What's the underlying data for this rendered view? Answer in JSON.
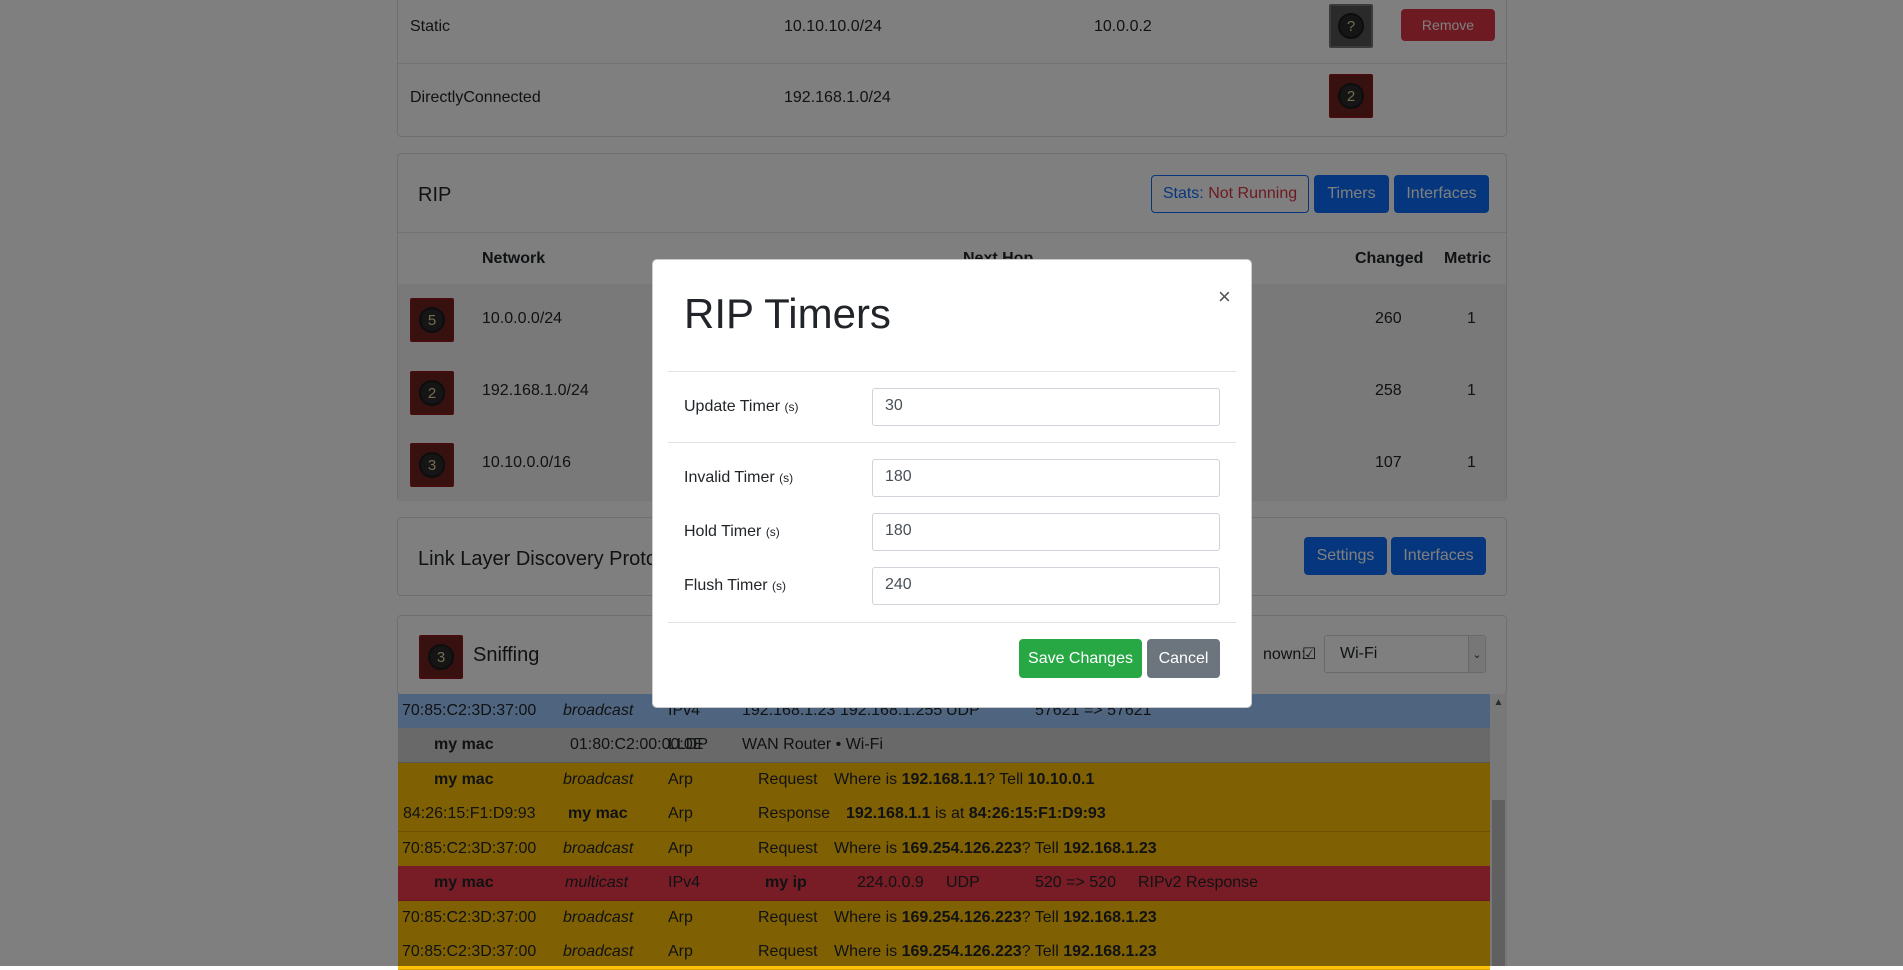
{
  "routes": [
    {
      "type": "Static",
      "network": "10.10.10.0/24",
      "next_hop": "10.0.0.2",
      "icon_label": "?",
      "remove_label": "Remove"
    },
    {
      "type": "DirectlyConnected",
      "network": "192.168.1.0/24",
      "next_hop": "",
      "icon_label": "2"
    }
  ],
  "rip": {
    "title": "RIP",
    "stats_prefix": "Stats:",
    "stats_value": "Not Running",
    "timers_button": "Timers",
    "interfaces_button": "Interfaces",
    "columns": {
      "network": "Network",
      "next_hop": "Next Hop",
      "changed": "Changed",
      "metric": "Metric"
    },
    "rows": [
      {
        "icon_label": "5",
        "network": "10.0.0.0/24",
        "changed": "260",
        "metric": "1"
      },
      {
        "icon_label": "2",
        "network": "192.168.1.0/24",
        "changed": "258",
        "metric": "1"
      },
      {
        "icon_label": "3",
        "network": "10.10.0.0/16",
        "changed": "107",
        "metric": "1"
      }
    ]
  },
  "lldp": {
    "title": "Link Layer Discovery Protocol",
    "settings_button": "Settings",
    "interfaces_button": "Interfaces"
  },
  "sniffing": {
    "icon_label": "3",
    "title": "Sniffing",
    "unknown_label": "nown:",
    "unknown_checkbox": "☑",
    "interface_select": "Wi-Fi",
    "packets": [
      {
        "color": "blue",
        "src": "70:85:C2:3D:37:00",
        "dst": "broadcast",
        "proto": "IPv4",
        "a": "192.168.1.23",
        "b": "192.168.1.255",
        "c": "UDP",
        "d": "57621 => 57621"
      },
      {
        "color": "grey",
        "src": "my mac",
        "dst": "01:80:C2:00:00:0E",
        "proto": "LLDP",
        "a": "WAN Router • Wi-Fi"
      },
      {
        "color": "yellow",
        "src": "my mac",
        "dst": "broadcast",
        "proto": "Arp",
        "op": "Request",
        "m1": "Where is ",
        "ip1": "192.168.1.1",
        "m2": "? Tell ",
        "ip2": "10.10.0.1"
      },
      {
        "color": "yellow",
        "src": "84:26:15:F1:D9:93",
        "dst": "my mac",
        "proto": "Arp",
        "op": "Response",
        "ip1": "192.168.1.1",
        "m1": " is at ",
        "ip2": "84:26:15:F1:D9:93"
      },
      {
        "color": "yellow",
        "src": "70:85:C2:3D:37:00",
        "dst": "broadcast",
        "proto": "Arp",
        "op": "Request",
        "m1": "Where is ",
        "ip1": "169.254.126.223",
        "m2": "? Tell ",
        "ip2": "192.168.1.23"
      },
      {
        "color": "red",
        "src": "my mac",
        "dst": "multicast",
        "proto": "IPv4",
        "a": "my ip",
        "b": "224.0.0.9",
        "c": "UDP",
        "d": "520 => 520",
        "e": "RIPv2 Response"
      },
      {
        "color": "yellow",
        "src": "70:85:C2:3D:37:00",
        "dst": "broadcast",
        "proto": "Arp",
        "op": "Request",
        "m1": "Where is ",
        "ip1": "169.254.126.223",
        "m2": "? Tell ",
        "ip2": "192.168.1.23"
      },
      {
        "color": "yellow",
        "src": "70:85:C2:3D:37:00",
        "dst": "broadcast",
        "proto": "Arp",
        "op": "Request",
        "m1": "Where is ",
        "ip1": "169.254.126.223",
        "m2": "? Tell ",
        "ip2": "192.168.1.23"
      }
    ]
  },
  "modal": {
    "title": "RIP Timers",
    "close": "×",
    "fields": [
      {
        "label": "Update Timer",
        "unit": "(s)",
        "value": "30"
      },
      {
        "label": "Invalid Timer",
        "unit": "(s)",
        "value": "180"
      },
      {
        "label": "Hold Timer",
        "unit": "(s)",
        "value": "180"
      },
      {
        "label": "Flush Timer",
        "unit": "(s)",
        "value": "240"
      }
    ],
    "save": "Save Changes",
    "cancel": "Cancel"
  }
}
